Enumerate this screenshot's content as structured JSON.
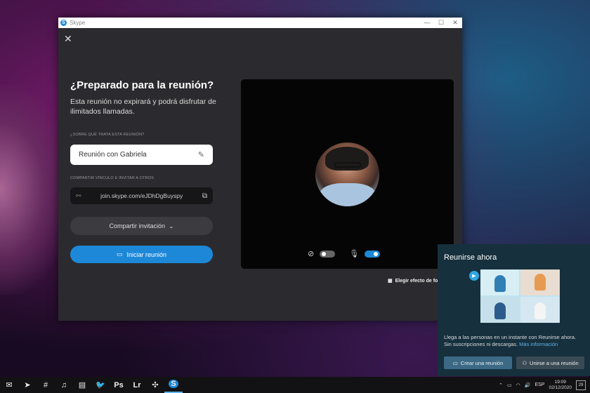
{
  "window": {
    "app_title": "Skype",
    "controls": [
      "—",
      "☐",
      "✕"
    ]
  },
  "meeting": {
    "heading": "¿Preparado para la reunión?",
    "description": "Esta reunión no expirará y podrá disfrutar de ilimitados llamadas.",
    "topic_label": "¿SOBRE QUÉ TRATA ESTA REUNIÓN?",
    "topic_value": "Reunión con Gabriela",
    "share_label": "COMPARTIR VÍNCULO E INVITAR A OTROS",
    "link": "join.skype.com/eJDhDgBuyspy",
    "share_button": "Compartir invitación",
    "start_button": "Iniciar reunión"
  },
  "preview": {
    "camera_enabled": false,
    "mic_enabled": true,
    "effect_label": "Elegir efecto de fo"
  },
  "panel": {
    "title": "Reunirse ahora",
    "text": "Llega a las personas en un instante con Reunirse ahora. Sin suscripciones ni descargas.",
    "more_link": "Más información",
    "create_button": "Crear una reunión",
    "join_button": "Unirse a una reunión"
  },
  "taskbar": {
    "icons": [
      "mail-icon",
      "telegram-icon",
      "slack-icon",
      "spotify-icon",
      "document-icon",
      "twitter-icon",
      "photoshop-icon",
      "lightroom-icon",
      "tweetdeck-icon",
      "skype-icon"
    ],
    "labels": [
      "✉",
      "➤",
      "#",
      "♫",
      "▤",
      "🐦",
      "Ps",
      "Lr",
      "✣",
      "S"
    ],
    "language": "ESP",
    "time": "19:09",
    "date": "02/12/2020",
    "notifications": "29"
  },
  "colors": {
    "accent": "#1e88d8",
    "window_bg": "#2b2b2f",
    "panel_bg": "#16303d"
  }
}
